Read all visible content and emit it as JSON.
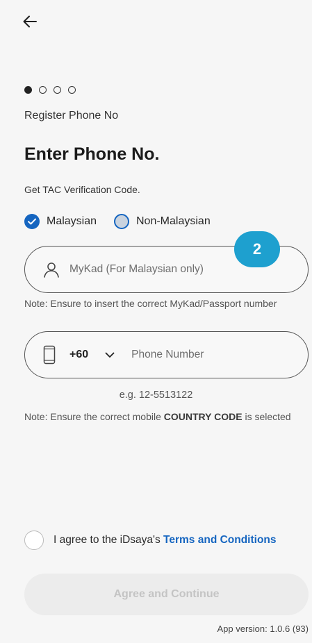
{
  "nav": {
    "back_icon": "arrow-left-icon"
  },
  "steps": {
    "total": 4,
    "current": 1
  },
  "step_label": "Register Phone No",
  "title": "Enter Phone No.",
  "subtitle": "Get TAC Verification Code.",
  "citizenship": {
    "options": [
      {
        "label": "Malaysian",
        "selected": true
      },
      {
        "label": "Non-Malaysian",
        "selected": false
      }
    ]
  },
  "badge": "2",
  "mykad": {
    "placeholder": "MyKad (For Malaysian only)",
    "icon": "person-icon",
    "note": "Note: Ensure to insert the correct MyKad/Passport number"
  },
  "phone": {
    "icon": "mobile-phone-icon",
    "country_code": "+60",
    "dropdown_icon": "chevron-down-icon",
    "placeholder": "Phone Number",
    "example": "e.g. 12-5513122",
    "note_prefix": "Note: Ensure the correct mobile ",
    "note_bold": "COUNTRY CODE",
    "note_suffix": " is selected"
  },
  "agreement": {
    "text": "I agree to the iDsaya's ",
    "link": "Terms and Conditions",
    "checked": false
  },
  "cta": {
    "label": "Agree and Continue",
    "enabled": false
  },
  "version": "App version: 1.0.6 (93)",
  "colors": {
    "accent": "#1565c0",
    "badge": "#1ea0cf",
    "background": "#f6f6f6"
  }
}
